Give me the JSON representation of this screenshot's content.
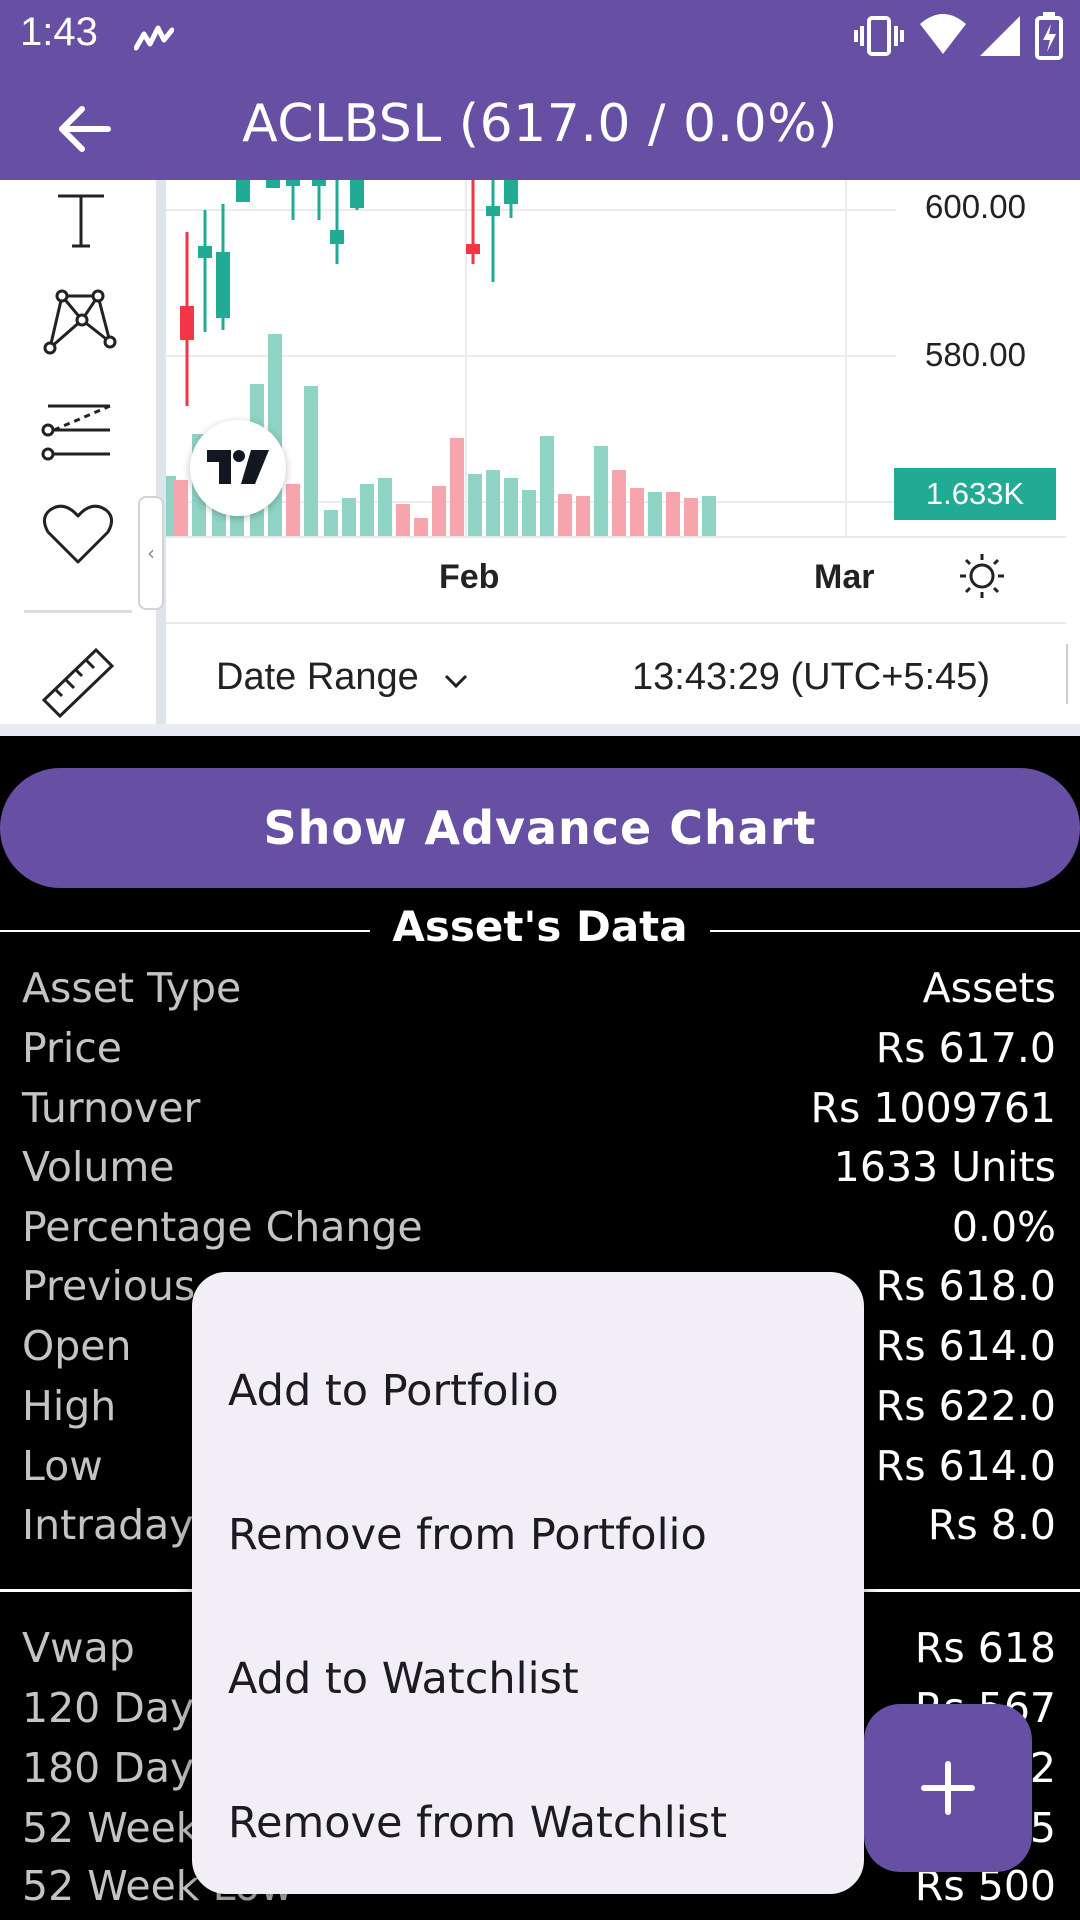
{
  "status_bar": {
    "time": "1:43"
  },
  "app_bar": {
    "title": "ACLBSL (617.0 / 0.0%)"
  },
  "chart": {
    "price_labels": [
      "600.00",
      "580.00"
    ],
    "volume_badge": "1.633K",
    "time_ticks": [
      "Feb",
      "Mar"
    ],
    "date_range_label": "Date Range",
    "clock": "13:43:29 (UTC+5:45)",
    "colors": {
      "up": "#22ab94",
      "down": "#f23645",
      "up_volume": "#8fd3c5",
      "down_volume": "#f6a5ad"
    }
  },
  "toolbar_icons": [
    "text-icon",
    "pattern-icon",
    "fib-lines-icon",
    "heart-icon",
    "ruler-icon"
  ],
  "advance_chart_button": "Show Advance Chart",
  "section_title": "Asset's Data",
  "rows": [
    {
      "label": "Asset Type",
      "value": "Assets"
    },
    {
      "label": "Price",
      "value": "Rs 617.0"
    },
    {
      "label": "Turnover",
      "value": "Rs 1009761"
    },
    {
      "label": "Volume",
      "value": "1633 Units"
    },
    {
      "label": "Percentage Change",
      "value": "0.0%"
    },
    {
      "label": "Previous",
      "value": "Rs 618.0"
    },
    {
      "label": "Open",
      "value": "Rs 614.0"
    },
    {
      "label": "High",
      "value": "Rs 622.0"
    },
    {
      "label": "Low",
      "value": "Rs 614.0"
    },
    {
      "label": "Intraday",
      "value": "Rs 8.0"
    }
  ],
  "rows2": [
    {
      "label": "Vwap",
      "value": "Rs 618"
    },
    {
      "label": "120 Day",
      "value": "Rs 567"
    },
    {
      "label": "180 Day",
      "value": "2"
    },
    {
      "label": "52 Week",
      "value": "5"
    },
    {
      "label": "52 Week Low",
      "value": "Rs 500"
    }
  ],
  "menu": {
    "items": [
      "Add to Portfolio",
      "Remove from Portfolio",
      "Add to Watchlist",
      "Remove from Watchlist"
    ]
  },
  "fab": {
    "icon": "plus-icon"
  },
  "colors": {
    "primary": "#6750a4",
    "background": "#000000",
    "menu_bg": "#f1eef5"
  }
}
